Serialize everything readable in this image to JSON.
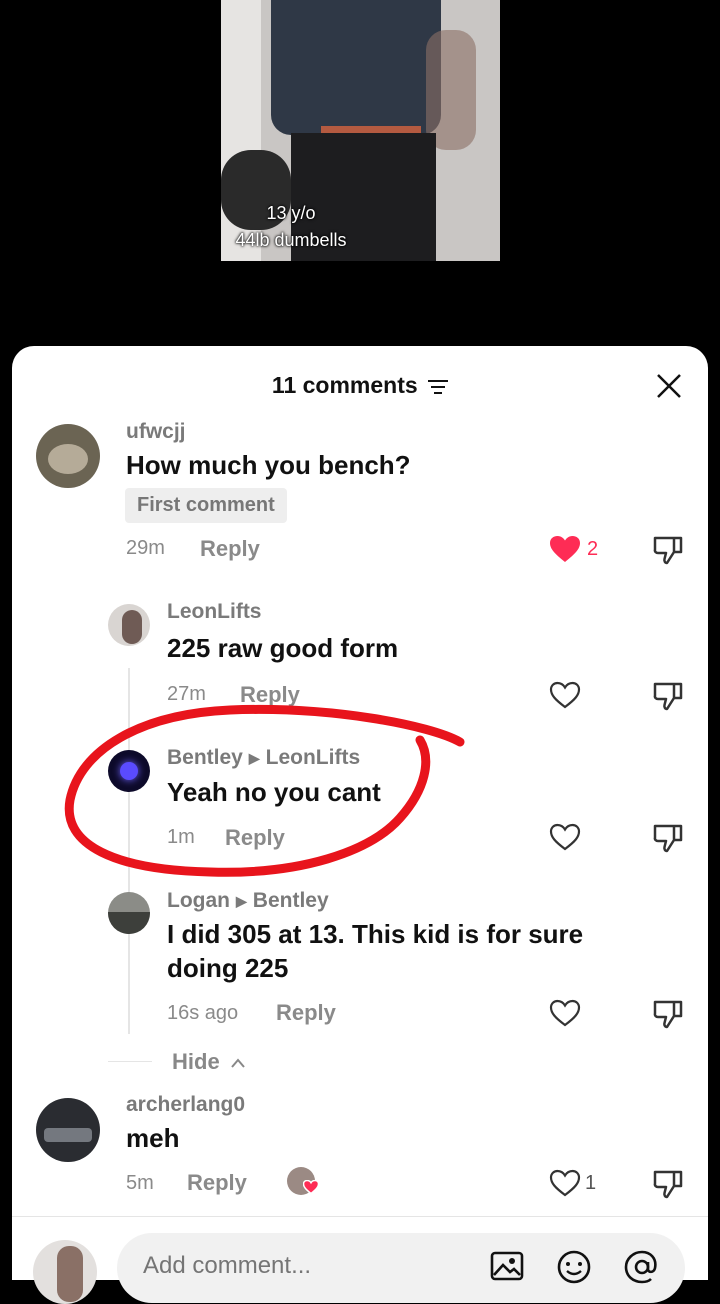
{
  "video": {
    "caption_line1": "13 y/o",
    "caption_line2": "44lb dumbells"
  },
  "header": {
    "title": "11 comments"
  },
  "comments": [
    {
      "username": "ufwcjj",
      "text": "How much you bench?",
      "badge": "First comment",
      "time": "29m",
      "reply_label": "Reply",
      "likes": "2"
    },
    {
      "username": "LeonLifts",
      "text": "225 raw good form",
      "time": "27m",
      "reply_label": "Reply"
    },
    {
      "username": "Bentley",
      "reply_to": "LeonLifts",
      "text": "Yeah no you cant",
      "time": "1m",
      "reply_label": "Reply"
    },
    {
      "username": "Logan",
      "reply_to": "Bentley",
      "text_line1": "I did 305 at 13. This kid is for sure",
      "text_line2": "doing 225",
      "time": "16s ago",
      "reply_label": "Reply"
    },
    {
      "username": "archerlang0",
      "text": "meh",
      "time": "5m",
      "reply_label": "Reply",
      "likes": "1"
    }
  ],
  "hide_label": "Hide",
  "composer": {
    "placeholder": "Add comment..."
  },
  "colors": {
    "liked_heart": "#fe2c55",
    "annotation": "#e8141c"
  }
}
